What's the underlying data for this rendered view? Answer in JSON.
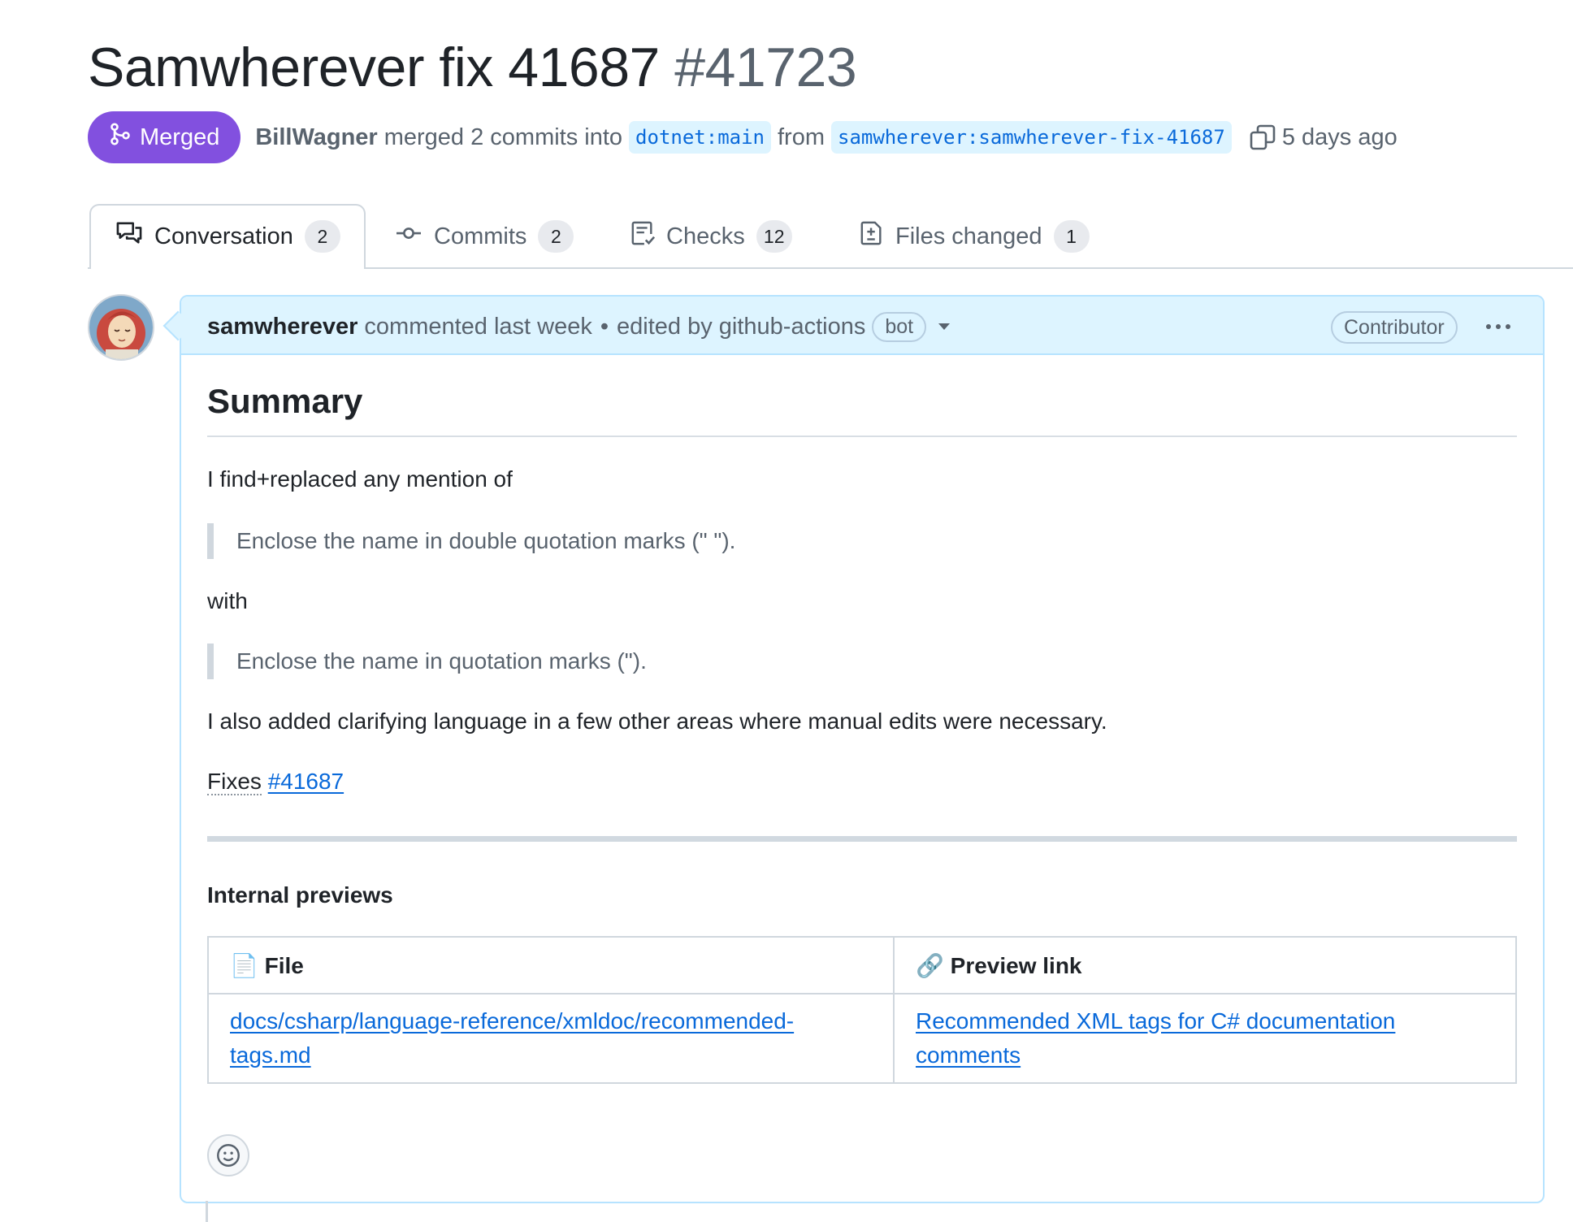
{
  "pr": {
    "title": "Samwherever fix 41687",
    "number": "#41723"
  },
  "meta": {
    "state": "Merged",
    "author": "BillWagner",
    "merged_text": "merged 2 commits into",
    "base_branch": "dotnet:main",
    "from_text": "from",
    "head_branch": "samwherever:samwherever-fix-41687",
    "time": "5 days ago"
  },
  "tabs": [
    {
      "label": "Conversation",
      "count": "2",
      "icon": "comment-discussion-icon"
    },
    {
      "label": "Commits",
      "count": "2",
      "icon": "git-commit-icon"
    },
    {
      "label": "Checks",
      "count": "12",
      "icon": "checklist-icon"
    },
    {
      "label": "Files changed",
      "count": "1",
      "icon": "file-diff-icon"
    }
  ],
  "comment": {
    "author": "samwherever",
    "action": "commented last week",
    "separator": "•",
    "edited": "edited by github-actions",
    "bot_label": "bot",
    "role": "Contributor",
    "heading": "Summary",
    "p1": "I find+replaced any mention of",
    "quote1": "Enclose the name in double quotation marks (\" \").",
    "p2": "with",
    "quote2": "Enclose the name in quotation marks (\").",
    "p3": "I also added clarifying language in a few other areas where manual edits were necessary.",
    "fixes_label": "Fixes",
    "fixes_link": "#41687",
    "previews_heading": "Internal previews",
    "table": {
      "headers": [
        "📄 File",
        "🔗 Preview link"
      ],
      "rows": [
        {
          "file_line1": "docs/csharp/language-reference/xmldoc/recommended-",
          "file_line2": "tags.md",
          "link_line1": "Recommended XML tags for C# documentation",
          "link_line2": "comments"
        }
      ]
    }
  },
  "colors": {
    "merged": "#8250df",
    "link": "#0969da",
    "header_bg": "#ddf4ff",
    "border": "#d0d7de"
  }
}
